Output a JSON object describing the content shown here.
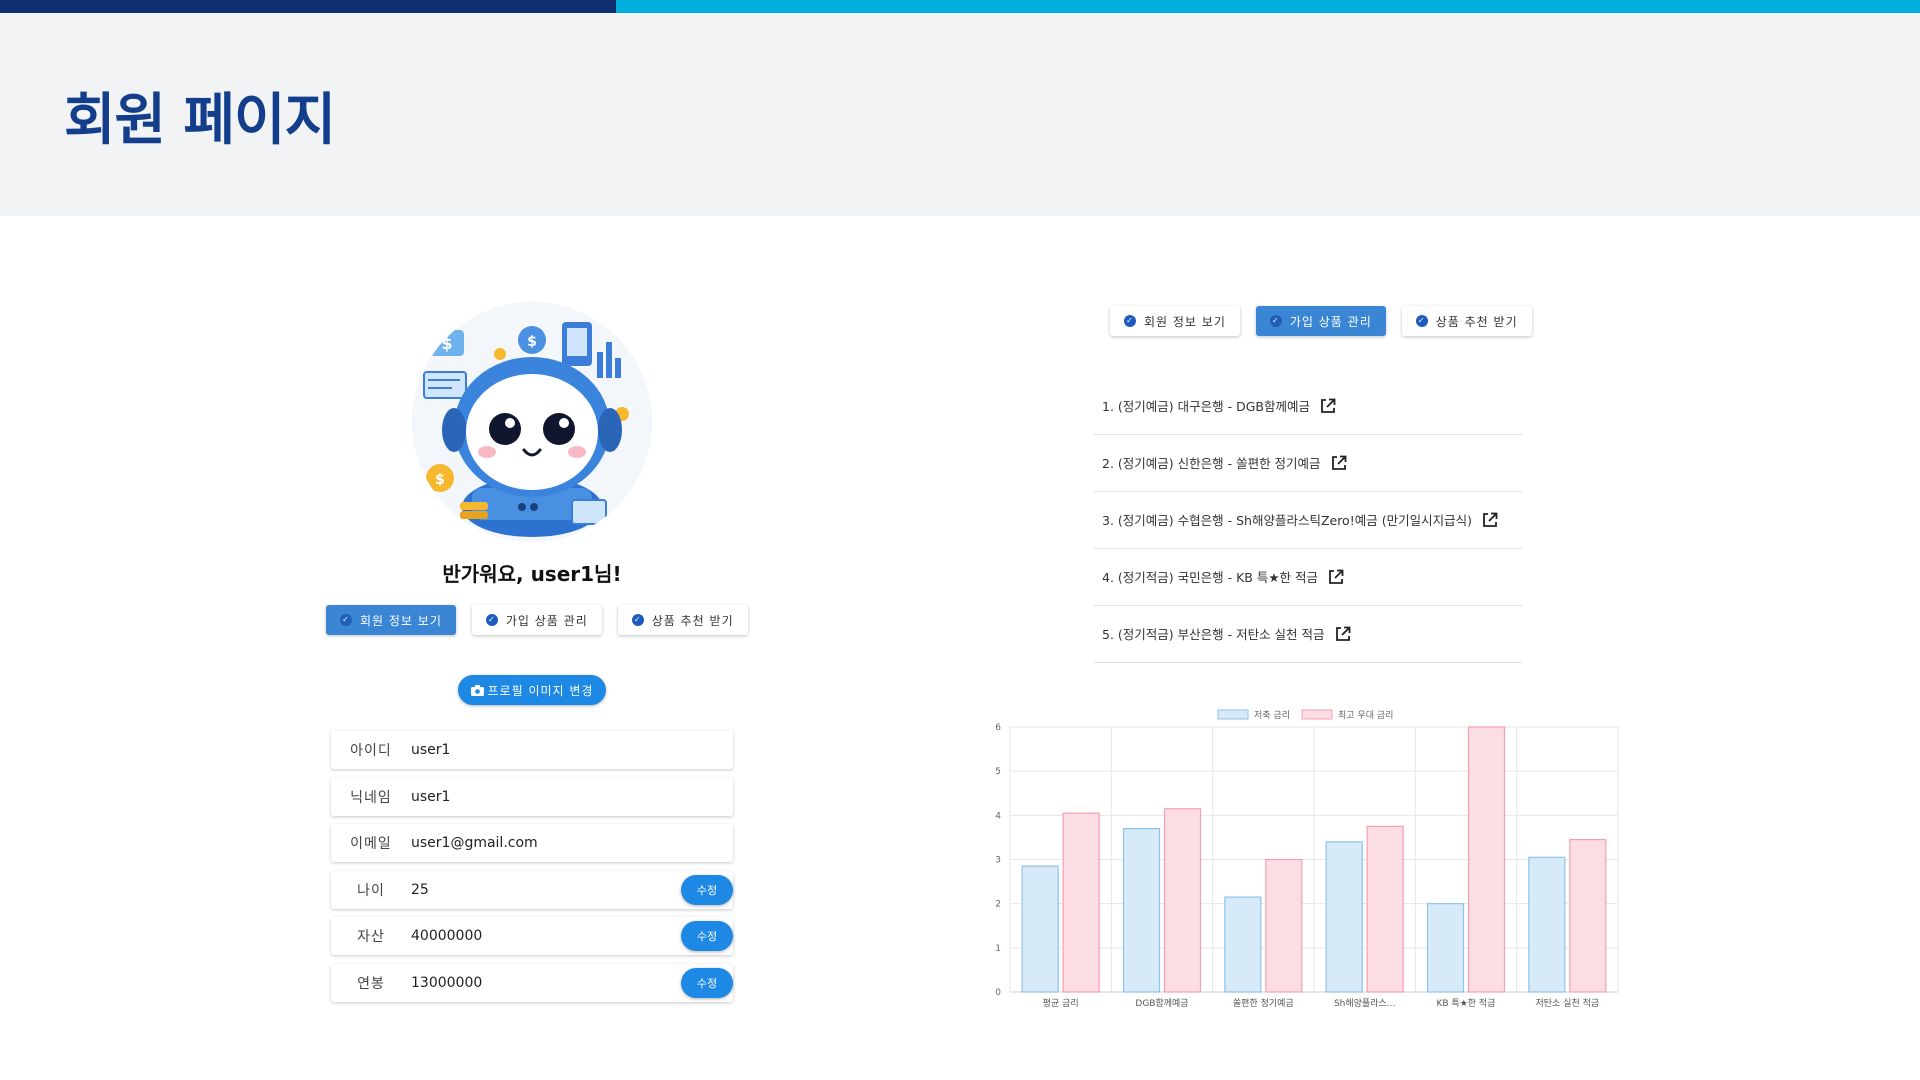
{
  "page": {
    "title": "회원 페이지"
  },
  "colors": {
    "top_dark": "#0f2f6e",
    "top_light": "#00aedb",
    "title": "#133e8c",
    "active_tab": "#3a86d4",
    "button": "#1e88e5",
    "bar_blue": "#d6eaf8",
    "bar_pink": "#fddde4"
  },
  "profile": {
    "greeting": "반가워요, user1님!",
    "photo_button": "프로필 이미지 변경",
    "tabs": [
      {
        "label": "회원 정보 보기",
        "active": true
      },
      {
        "label": "가입 상품 관리",
        "active": false
      },
      {
        "label": "상품 추천 받기",
        "active": false
      }
    ],
    "fields": [
      {
        "label": "아이디",
        "value": "user1",
        "editable": false
      },
      {
        "label": "닉네임",
        "value": "user1",
        "editable": false
      },
      {
        "label": "이메일",
        "value": "user1@gmail.com",
        "editable": false
      },
      {
        "label": "나이",
        "value": "25",
        "editable": true
      },
      {
        "label": "자산",
        "value": "40000000",
        "editable": true
      },
      {
        "label": "연봉",
        "value": "13000000",
        "editable": true
      }
    ],
    "edit_label": "수정"
  },
  "products": {
    "tabs": [
      {
        "label": "회원 정보 보기",
        "active": false
      },
      {
        "label": "가입 상품 관리",
        "active": true
      },
      {
        "label": "상품 추천 받기",
        "active": false
      }
    ],
    "items": [
      "1. (정기예금) 대구은행 - DGB함께예금",
      "2. (정기예금) 신한은행 - 쏠편한 정기예금",
      "3. (정기예금) 수협은행 - Sh해양플라스틱Zero!예금 (만기일시지급식)",
      "4. (정기적금) 국민은행 - KB 특★한 적금",
      "5. (정기적금) 부산은행 - 저탄소 실천 적금"
    ]
  },
  "chart_data": {
    "type": "bar",
    "categories": [
      "평균 금리",
      "DGB함께예금",
      "쏠편한 정기예금",
      "Sh해양플라스...",
      "KB 특★한 적금",
      "저탄소 실천 적금"
    ],
    "series": [
      {
        "name": "저축 금리",
        "values": [
          2.85,
          3.7,
          2.15,
          3.4,
          2.0,
          3.05
        ],
        "color": "#d6eaf8",
        "stroke": "#8fc3ea"
      },
      {
        "name": "최고 우대 금리",
        "values": [
          4.05,
          4.15,
          3.0,
          3.75,
          6.0,
          3.45
        ],
        "color": "#fddde4",
        "stroke": "#f3a0b3"
      }
    ],
    "ylim": [
      0,
      6
    ],
    "yticks": [
      0,
      1,
      2,
      3,
      4,
      5,
      6
    ],
    "legend_position": "top",
    "grid": true
  }
}
